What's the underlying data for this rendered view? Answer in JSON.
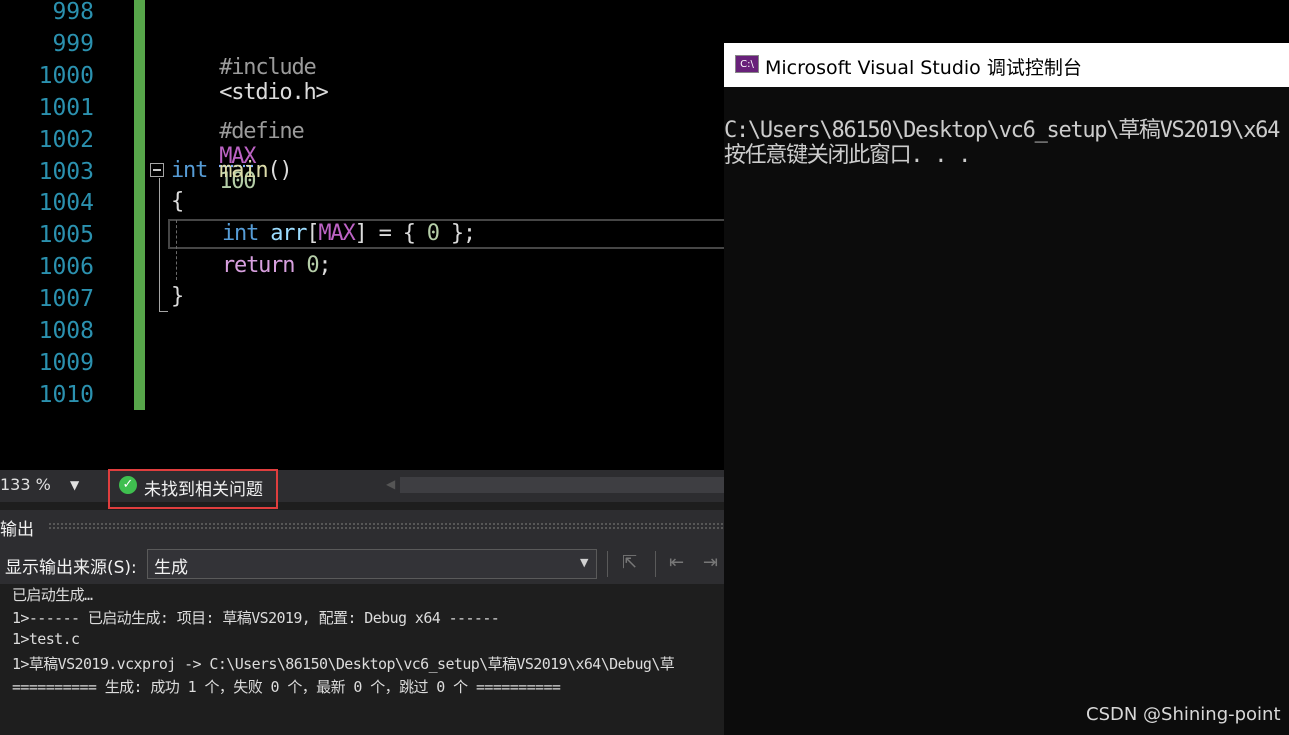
{
  "editor": {
    "line_numbers": [
      "998",
      "999",
      "1000",
      "1001",
      "1002",
      "1003",
      "1004",
      "1005",
      "1006",
      "1007",
      "1008",
      "1009",
      "1010"
    ],
    "code": {
      "include_kw": "#include",
      "include_hdr": "<stdio.h>",
      "define_kw": "#define",
      "define_name": "MAX",
      "define_val": "100",
      "main_type": "int",
      "main_name": "main",
      "main_parens": "()",
      "open_brace": "{",
      "arr_type": "int",
      "arr_name": "arr",
      "arr_open": "[",
      "arr_size": "MAX",
      "arr_rest": "] = { ",
      "arr_init": "0",
      "arr_end": " };",
      "ret_kw": "return",
      "ret_val": "0",
      "ret_end": ";",
      "close_brace": "}"
    }
  },
  "status": {
    "zoom": "133 %",
    "issues_text": "未找到相关问题"
  },
  "output": {
    "title": "输出",
    "source_label": "显示输出来源(S):",
    "source_value": "生成",
    "lines": [
      "已启动生成…",
      "1>------ 已启动生成: 项目: 草稿VS2019, 配置: Debug x64 ------",
      "1>test.c",
      "1>草稿VS2019.vcxproj -> C:\\Users\\86150\\Desktop\\vc6_setup\\草稿VS2019\\x64\\Debug\\草",
      "========== 生成: 成功 1 个，失败 0 个，最新 0 个，跳过 0 个 =========="
    ]
  },
  "console": {
    "title": "Microsoft Visual Studio 调试控制台",
    "icon_text": "C:\\",
    "lines": [
      "C:\\Users\\86150\\Desktop\\vc6_setup\\草稿VS2019\\x64",
      "按任意键关闭此窗口. . ."
    ]
  },
  "watermark": "CSDN @Shining-point"
}
